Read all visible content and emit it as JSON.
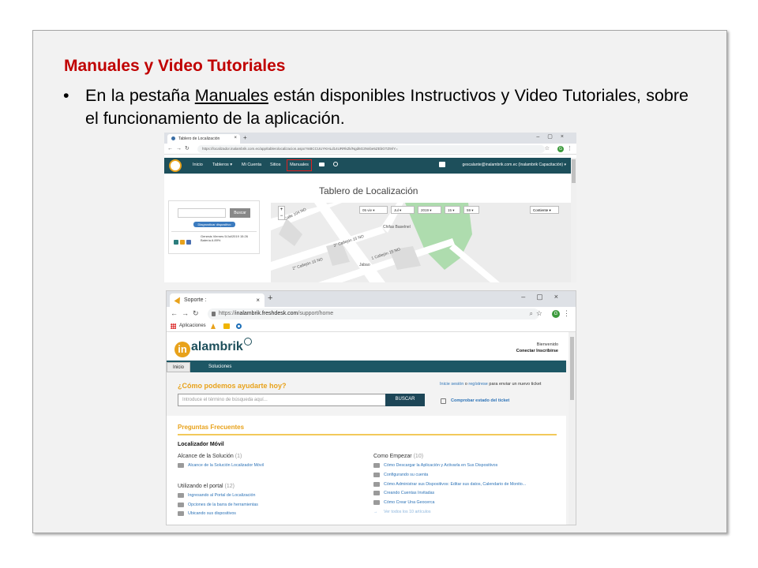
{
  "slide": {
    "title": "Manuales y Video Tutoriales",
    "bullet_symbol": "•",
    "bullet_pre": "En la pestaña ",
    "bullet_link": "Manuales",
    "bullet_post": " están disponibles Instructivos y Video Tutoriales, sobre el funcionamiento de la aplicación."
  },
  "shot1": {
    "tab_title": "Tablero de Localización",
    "url": "https://localizador.inalambrik.com.ec/app/tablerolocalizacion.aspx?mBCCUUYKHLd14URRkZk/Ngd6G3Nnbe5ZEbGTZ9I/Y=",
    "nav": [
      "Inicio",
      "Tableros ▾",
      "Mi Cuenta",
      "Sitios"
    ],
    "nav_active": "Manuales",
    "user": "gescalante@inalambrik.com.ec (Inalambrik Capacitación) ▾",
    "heading": "Tablero de Localización",
    "search_button": "Buscar",
    "diagnose_button": "Diagnosticar dispositivo",
    "device_text": "Genesis Viernes 5/Jul/2019 15:26 Batería A 89%",
    "zoom_in": "+",
    "zoom_out": "−",
    "controls": [
      "05 vie ▾",
      "Jul ▾",
      "2019 ▾",
      "15 ▾",
      "59 ▾"
    ],
    "map_type": "Contiente ▾",
    "map_labels": [
      "Calle 104 NO",
      "3° Callejón 15 NO",
      "2° Callejón 15 NO",
      "1 Callejón 15 NO",
      "Chifas Baselnel",
      "Jabao"
    ]
  },
  "shot2": {
    "tab_title": "Soporte :",
    "url_scheme": "https://",
    "url_host": "inalambrik.freshdesk.com",
    "url_path": "/support/home",
    "bookmarks_label": "Aplicaciones",
    "logo_in": "in",
    "logo_rest": "alambrik",
    "welcome": "Bienvenido",
    "connect": "Conectar",
    "register": "Inscribirse",
    "tabs": [
      "Inicio",
      "Soluciones"
    ],
    "question": "¿Cómo podemos ayudarte hoy?",
    "search_placeholder": "Introduce el término de búsqueda aquí...",
    "search_button": "BUSCAR",
    "login_link": "Inicie sesión",
    "login_o": " o ",
    "register_link": "regístrese",
    "login_rest": " para enviar un nuevo ticket",
    "check_status": "Comprobar estado del ticket",
    "faq_heading": "Preguntas Frecuentes",
    "category": "Localizador Móvil",
    "left_sections": [
      {
        "title": "Alcance de la Solución",
        "count": "(1)",
        "articles": [
          "Alcance de la Solución Localizador Móvil"
        ]
      },
      {
        "title": "Utilizando el portal",
        "count": "(12)",
        "articles": [
          "Ingresando al Portal de Localización",
          "Opciones de la barra de herramientas",
          "Ubicando sus dispositivos"
        ]
      }
    ],
    "right_section": {
      "title": "Como Empezar",
      "count": "(10)",
      "articles": [
        "Cómo Descargar la Aplicación y Activarla en Sus Dispositivos",
        "Configurando su cuenta",
        "Cómo Administrar sus Dispositivos: Editar sus datos, Calendario de Monito...",
        "Creando Cuentas Invitadas",
        "Cómo Crear Una Geocerca"
      ],
      "more": "Ver todos los 10 artículos"
    }
  },
  "colors": {
    "title_red": "#c00000",
    "navbar_teal": "#1d4f5b",
    "accent_orange": "#e8a21b",
    "link_blue": "#2d73b7",
    "highlight_red": "#e02020"
  },
  "icons": [
    "close-icon",
    "plus-icon",
    "back-icon",
    "forward-icon",
    "reload-icon",
    "lock-icon",
    "star-icon",
    "profile-icon",
    "menu-icon",
    "chat-icon",
    "youtube-icon",
    "headset-icon",
    "book-icon",
    "apps-icon",
    "ticket-icon"
  ]
}
